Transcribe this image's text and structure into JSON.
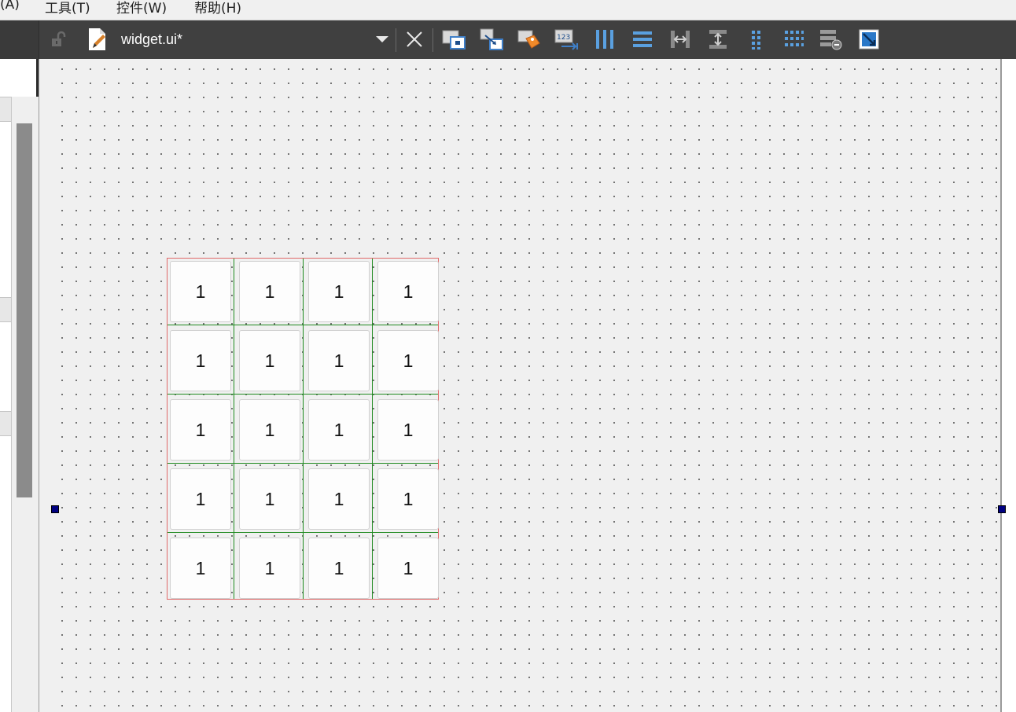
{
  "menu": {
    "items": [
      "(A)",
      "工具(T)",
      "控件(W)",
      "帮助(H)"
    ]
  },
  "toolbar": {
    "file_name": "widget.ui*",
    "icons": [
      "lock-icon",
      "edit-file-icon",
      "dropdown-icon",
      "close-icon",
      "edit-widgets-icon",
      "edit-signals-slots-icon",
      "edit-buddies-icon",
      "edit-tab-order-icon",
      "layout-horizontal-icon",
      "layout-vertical-icon",
      "layout-horizontal-splitter-icon",
      "layout-vertical-splitter-icon",
      "layout-form-icon",
      "layout-grid-icon",
      "break-layout-icon",
      "adjust-size-icon"
    ]
  },
  "grid": {
    "rows": [
      [
        "1",
        "1",
        "1",
        "1"
      ],
      [
        "1",
        "1",
        "1",
        "1"
      ],
      [
        "1",
        "1",
        "1",
        "1"
      ],
      [
        "1",
        "1",
        "1",
        "1"
      ],
      [
        "1",
        "1",
        "1",
        "1"
      ]
    ]
  },
  "colors": {
    "toolbar_bg": "#404040",
    "canvas_bg": "#f0f0f0",
    "grid_border": "#e06a6a",
    "grid_lines": "#1f8a1f",
    "handle": "#000080"
  }
}
